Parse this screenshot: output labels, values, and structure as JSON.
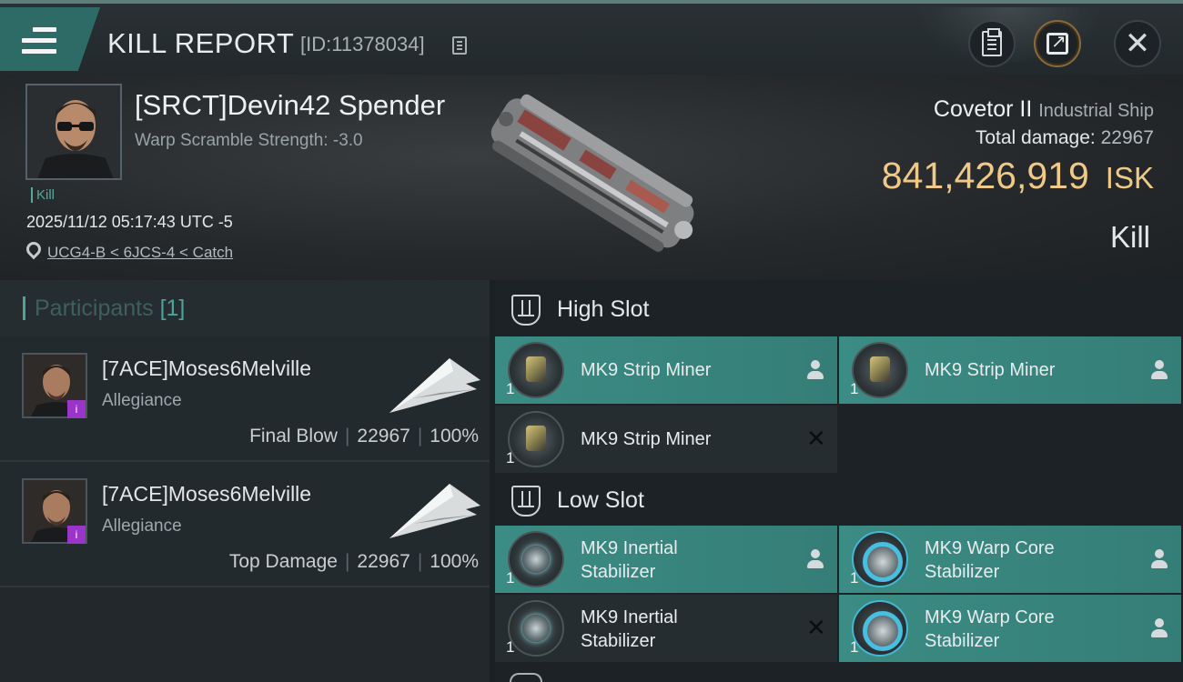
{
  "header": {
    "title": "KILL REPORT",
    "report_id": "[ID:11378034]"
  },
  "victim": {
    "name": "[SRCT]Devin42 Spender",
    "warp_scramble": "Warp Scramble Strength: -3.0",
    "tag": "Kill",
    "datetime": "2025/11/12 05:17:43 UTC -5",
    "location": "UCG4-B < 6JCS-4 < Catch",
    "ship_name": "Covetor II",
    "ship_class": "Industrial Ship",
    "total_damage_label": "Total damage:",
    "total_damage": "22967",
    "isk_value": "841,426,919",
    "isk_unit": "ISK",
    "result": "Kill"
  },
  "participants": {
    "title": "Participants",
    "count": "[1]",
    "rows": [
      {
        "name": "[7ACE]Moses6Melville",
        "corp": "Allegiance",
        "role": "Final Blow",
        "damage": "22967",
        "percent": "100%",
        "badge": "i"
      },
      {
        "name": "[7ACE]Moses6Melville",
        "corp": "Allegiance",
        "role": "Top Damage",
        "damage": "22967",
        "percent": "100%",
        "badge": "i"
      }
    ]
  },
  "slots": {
    "high": {
      "title": "High Slot",
      "modules": [
        {
          "name": "MK9 Strip Miner",
          "qty": "1",
          "state": "fitted",
          "icon": "strip-miner-icon"
        },
        {
          "name": "MK9 Strip Miner",
          "qty": "1",
          "state": "fitted",
          "icon": "strip-miner-icon"
        },
        {
          "name": "MK9 Strip Miner",
          "qty": "1",
          "state": "destroyed",
          "icon": "strip-miner-icon"
        }
      ]
    },
    "low": {
      "title": "Low Slot",
      "modules": [
        {
          "name_line1": "MK9 Inertial",
          "name_line2": "Stabilizer",
          "qty": "1",
          "state": "fitted",
          "icon": "inertial-stabilizer-icon"
        },
        {
          "name_line1": "MK9 Warp Core",
          "name_line2": "Stabilizer",
          "qty": "1",
          "state": "fitted",
          "icon": "warp-core-stabilizer-icon"
        },
        {
          "name_line1": "MK9 Inertial",
          "name_line2": "Stabilizer",
          "qty": "1",
          "state": "destroyed",
          "icon": "inertial-stabilizer-icon"
        },
        {
          "name_line1": "MK9 Warp Core",
          "name_line2": "Stabilizer",
          "qty": "1",
          "state": "fitted",
          "icon": "warp-core-stabilizer-icon"
        }
      ]
    }
  },
  "colors": {
    "accent_teal": "#3b8c84",
    "isk_gold": "#f0c987",
    "badge_purple": "#9b34c9"
  }
}
